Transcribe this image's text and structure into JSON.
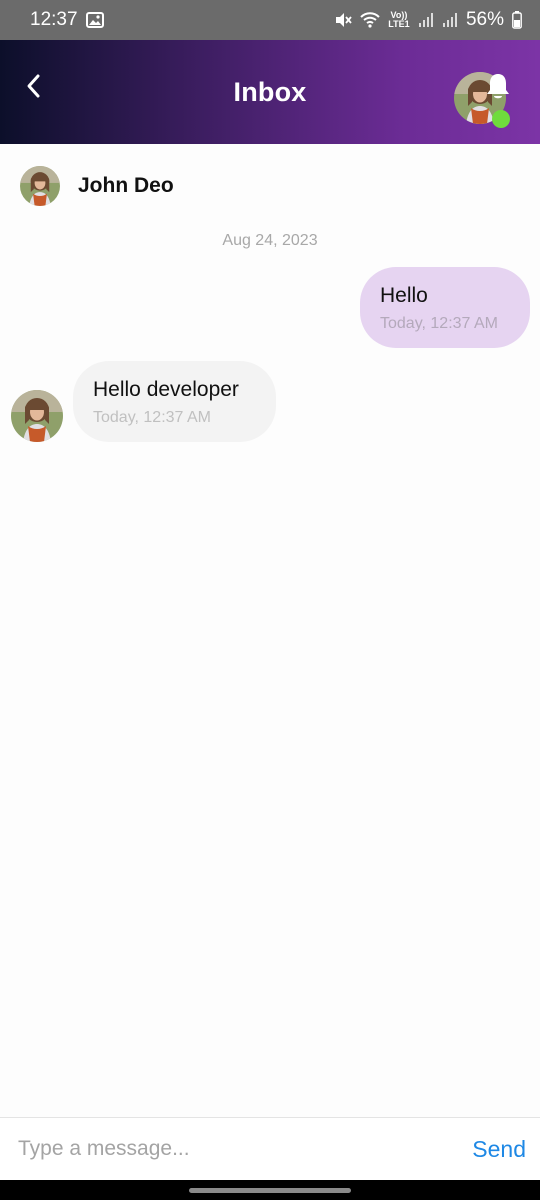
{
  "status_bar": {
    "time": "12:37",
    "battery": "56%",
    "network_label": "Vo)) LTE1"
  },
  "header": {
    "title": "Inbox",
    "gradient_colors": [
      "#0c0f2a",
      "#3a1d5e",
      "#6c2c96",
      "#7c34a6"
    ],
    "online_color": "#6fdc3c"
  },
  "contact": {
    "name": "John Deo"
  },
  "conversation": {
    "date": "Aug 24, 2023",
    "messages": [
      {
        "direction": "outgoing",
        "text": "Hello",
        "time": "Today, 12:37 AM",
        "bubble_color": "#e6d4f1"
      },
      {
        "direction": "incoming",
        "text": "Hello developer",
        "time": "Today, 12:37 AM",
        "bubble_color": "#f3f3f3"
      }
    ]
  },
  "composer": {
    "placeholder": "Type a message...",
    "send_label": "Send",
    "accent": "#1e88e5"
  },
  "icons": [
    "image-icon",
    "mute-icon",
    "wifi-icon",
    "signal-icon",
    "battery-icon",
    "back-arrow-icon",
    "bell-icon",
    "online-status-icon"
  ]
}
